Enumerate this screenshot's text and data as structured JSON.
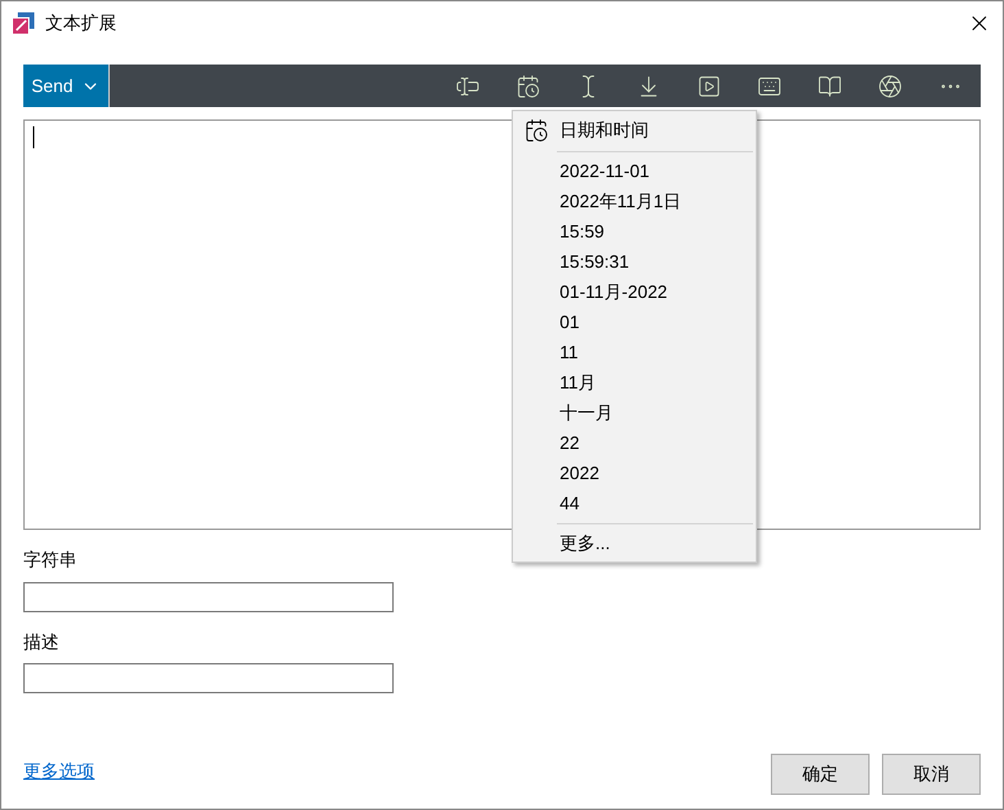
{
  "window": {
    "title": "文本扩展"
  },
  "toolbar": {
    "send_button": "Send"
  },
  "menu": {
    "header": "日期和时间",
    "items": [
      "2022-11-01",
      "2022年11月1日",
      "15:59",
      "15:59:31",
      "01-11月-2022",
      "01",
      "11",
      "11月",
      "十一月",
      "22",
      "2022",
      "44"
    ],
    "footer": "更多..."
  },
  "fields": [
    {
      "label": "字符串"
    },
    {
      "label": "描述"
    }
  ],
  "more_options_link": "更多选项",
  "buttons": [
    "确定",
    "取消"
  ]
}
